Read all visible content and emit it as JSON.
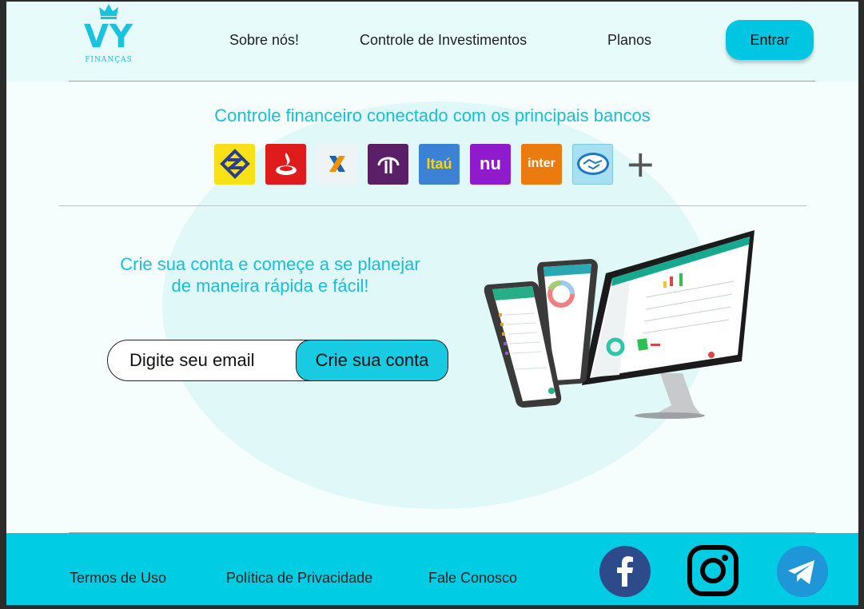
{
  "brand": {
    "mark": "VY",
    "sub": "FINANÇAS"
  },
  "nav": {
    "items": [
      "Sobre nós!",
      "Controle de Investimentos",
      "Planos"
    ],
    "login_label": "Entrar"
  },
  "banks_section": {
    "title": "Controle financeiro conectado com os principais bancos",
    "banks": [
      {
        "name": "banco-do-brasil",
        "color": "#f9e017"
      },
      {
        "name": "santander",
        "color": "#e01b1b"
      },
      {
        "name": "caixa",
        "color": "#eef4f6"
      },
      {
        "name": "bradesco",
        "color": "#5a1f66"
      },
      {
        "name": "itau",
        "label": "Itaú",
        "color": "#3b82d6"
      },
      {
        "name": "nubank",
        "label": "nu",
        "color": "#8f1bcc"
      },
      {
        "name": "inter",
        "label": "inter",
        "color": "#ea7b10"
      },
      {
        "name": "mercado-pago",
        "color": "#a7e0f2"
      }
    ],
    "more_symbol": "+"
  },
  "cta": {
    "line1": "Crie sua conta e começe a se planejar",
    "line2": "de maneira rápida e fácil!",
    "email_placeholder": "Digite seu email",
    "button_label": "Crie sua conta"
  },
  "footer": {
    "links": [
      "Termos de Uso",
      "Política de Privacidade",
      "Fale Conosco"
    ],
    "social_icons": [
      "facebook-icon",
      "instagram-icon",
      "telegram-icon"
    ]
  },
  "colors": {
    "accent": "#00cde3",
    "heading": "#18bfd8",
    "header_bg": "#e8fbfb",
    "page_bg": "#f6fefd"
  }
}
